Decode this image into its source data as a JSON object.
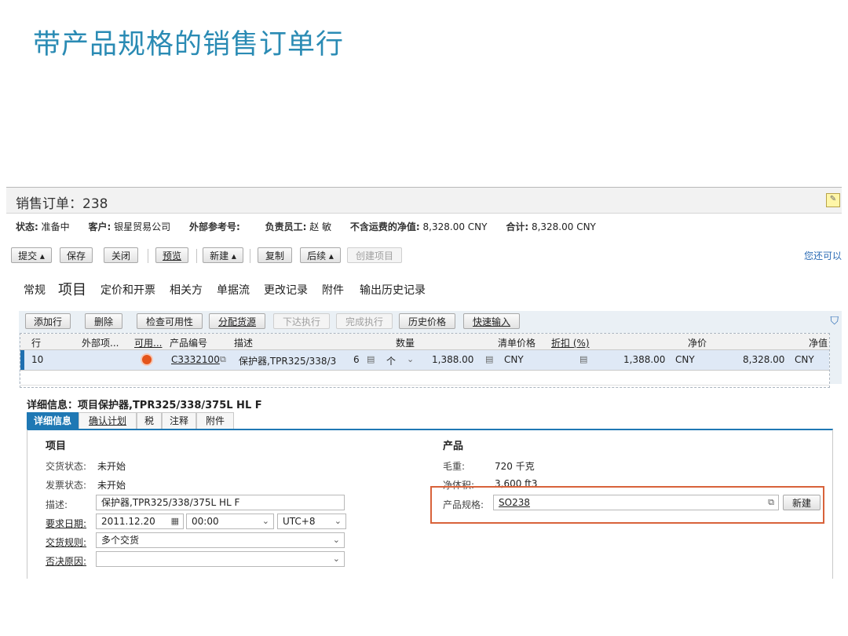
{
  "slide_title": "带产品规格的销售订单行",
  "header": {
    "title": "销售订单：238"
  },
  "status_bar": {
    "status_label": "状态:",
    "status_value": "准备中",
    "customer_label": "客户:",
    "customer_value": "银星贸易公司",
    "extref_label": "外部参考号:",
    "employee_label": "负责员工:",
    "employee_value": "赵 敏",
    "net_label": "不含运费的净值:",
    "net_value": "8,328.00  CNY",
    "total_label": "合计:",
    "total_value": "8,328.00  CNY"
  },
  "toolbar": {
    "submit": "提交",
    "save": "保存",
    "close": "关闭",
    "preview": "预览",
    "new": "新建",
    "copy": "复制",
    "follow": "后续",
    "create_item": "创建项目",
    "right_link": "您还可以"
  },
  "tabs": [
    "常规",
    "项目",
    "定价和开票",
    "相关方",
    "单据流",
    "更改记录",
    "附件",
    "输出历史记录"
  ],
  "item_toolbar": {
    "add_row": "添加行",
    "delete": "删除",
    "check_avail": "检查可用性",
    "assign_source": "分配货源",
    "release": "下达执行",
    "finish": "完成执行",
    "history_price": "历史价格",
    "quick_entry": "快速输入"
  },
  "table": {
    "headers": {
      "row": "行",
      "ext": "外部项...",
      "avail": "可用...",
      "product_id": "产品编号",
      "desc": "描述",
      "qty": "数量",
      "list_price": "清单价格",
      "discount": "折扣 (%)",
      "net_price": "净价",
      "net_value": "净值"
    },
    "row": {
      "row": "10",
      "product_id": "C3332100",
      "desc": "保护器,TPR325/338/3",
      "qty": "6",
      "unit": "个",
      "list_price": "1,388.00",
      "list_cur": "CNY",
      "net_price": "1,388.00",
      "net_cur": "CNY",
      "net_value": "8,328.00",
      "value_cur": "CNY"
    }
  },
  "details": {
    "title": "详细信息：项目保护器,TPR325/338/375L HL F",
    "tabs": [
      "详细信息",
      "确认计划",
      "税",
      "注释",
      "附件"
    ],
    "item_section": "项目",
    "delivery_status_label": "交货状态:",
    "delivery_status": "未开始",
    "invoice_status_label": "发票状态:",
    "invoice_status": "未开始",
    "desc_label": "描述:",
    "desc_value": "保护器,TPR325/338/375L HL F",
    "req_date_label": "要求日期:",
    "req_date": "2011.12.20",
    "req_time": "00:00",
    "timezone": "UTC+8",
    "delivery_rule_label": "交货规则:",
    "delivery_rule": "多个交货",
    "reject_reason_label": "否决原因:",
    "reject_reason": "",
    "product_section": "产品",
    "gross_weight_label": "毛重:",
    "gross_weight": "720  千克",
    "net_volume_label": "净体积:",
    "net_volume": "3,600  ft3",
    "spec_label": "产品规格:",
    "spec_value": "SO238",
    "new_button": "新建"
  },
  "colors": {
    "title_blue": "#2a8bb4",
    "accent": "#1f78b4",
    "highlight": "#d8623a",
    "status_dot": "#e4541b"
  }
}
